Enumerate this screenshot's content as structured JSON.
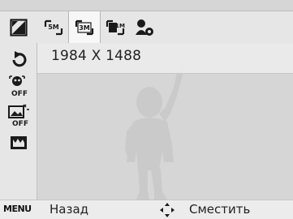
{
  "top_options": {
    "items": [
      {
        "id": "mode",
        "icon": "resolution-menu-icon"
      },
      {
        "id": "5m",
        "sub": "5M",
        "icon": "resolution-5m-icon"
      },
      {
        "id": "3m",
        "sub": "3M",
        "icon": "resolution-3m-icon",
        "selected": true
      },
      {
        "id": "1m",
        "sub": "1M",
        "icon": "resolution-1m-icon"
      },
      {
        "id": "face",
        "icon": "face-capture-icon"
      }
    ]
  },
  "left_menu": {
    "items": [
      {
        "id": "mode",
        "icon": "resolution-menu-icon"
      },
      {
        "id": "rotate",
        "icon": "rotate-icon"
      },
      {
        "id": "face-off",
        "text": "OFF",
        "icon": "face-detect-off-icon"
      },
      {
        "id": "stabilizer-off",
        "text": "OFF",
        "icon": "smart-auto-off-icon"
      },
      {
        "id": "scene",
        "icon": "scene-mode-icon"
      }
    ]
  },
  "info": {
    "resolution": "1984 X 1488"
  },
  "bottom": {
    "menu_key": "MENU",
    "back_label": "Назад",
    "move_label": "Сместить"
  },
  "colors": {
    "icon_dark": "#1a1a1a",
    "bar_bg": "#e6e6e6",
    "silhouette": "#c8c8c8"
  }
}
